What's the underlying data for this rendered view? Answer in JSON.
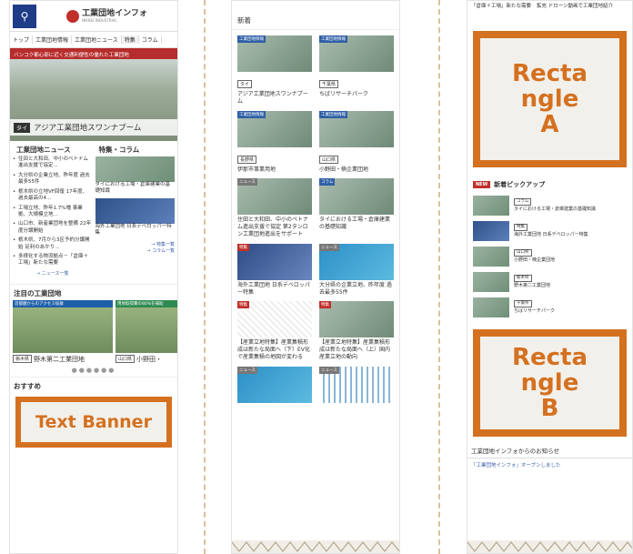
{
  "phone1": {
    "logo_text": "工業団地インフォ",
    "logo_sub": "NIKKEI INDUSTRIAL",
    "tabs": [
      "トップ",
      "工業団地情報",
      "工業団地ニュース",
      "特集",
      "コラム"
    ],
    "banner_text": "バンコク都心部に近く交通利便性の優れた工業団地",
    "hero_tag": "タイ",
    "hero_title": "アジア工業団地スワンナプーム",
    "news_title": "工業団地ニュース",
    "news_items": [
      "住田と大和田、中小のベトナム進出支援で協定…",
      "大分県の企業立地、昨年度 過去最多55件",
      "栃木県の立地VF回復 17年度、過去最高の4…",
      "工場立地、昨年1.7%増 事業拠、大規模立地…",
      "山口市、新産業団地を整備 22年度分譲開始",
      "栃木県、7月から3区予約分譲開始 足利のあかり…",
      "多様化する物流拠点－「倉庫＋工場」新たな需要"
    ],
    "news_more": "→ ニュース一覧",
    "feature_title": "特集・コラム",
    "features": [
      "タイにおける工場・倉庫建業の基礎知識",
      "海外工業団地 日系デベロッパー特集"
    ],
    "feature_more": "→ 特集一覧\n→ コラム一覧",
    "notable_title": "注目の工業団地",
    "carousel": [
      {
        "ribbon": "首都圏からのアクセス抜群",
        "pref": "栃木県",
        "name": "野木第二工業団地"
      },
      {
        "ribbon": "用地取得費の80%を補助",
        "pref": "山口県",
        "name": "小野田・"
      }
    ],
    "dots": "●●●●●●",
    "osusume": "おすすめ",
    "text_banner": "Text Banner"
  },
  "phone2": {
    "title": "新着",
    "cards": [
      {
        "label": "工業団地情報",
        "pref": "タイ",
        "caption": "アジア工業団地スワンナプーム",
        "style": ""
      },
      {
        "label": "工業団地情報",
        "pref": "千葉県",
        "caption": "ちばリサーチパーク",
        "style": ""
      },
      {
        "label": "工業団地情報",
        "pref": "長野県",
        "caption": "伊那市事業用地",
        "style": ""
      },
      {
        "label": "工業団地情報",
        "pref": "山口県",
        "caption": "小野田・楠企業団地",
        "style": ""
      },
      {
        "label": "ニュース",
        "pref": "",
        "caption": "住田と大和田、中小のベトナム進出支援で協定 第2タンロン工業団地進出をサポート",
        "style": ""
      },
      {
        "label": "コラム",
        "pref": "",
        "caption": "タイにおける工場・倉庫建業の基礎知識",
        "style": ""
      },
      {
        "label": "特集",
        "pref": "",
        "caption": "海外工業団地 日系デベロッパー特集",
        "style": "map"
      },
      {
        "label": "ニュース",
        "pref": "",
        "caption": "大分県の企業立地、昨年度 過去最多55件",
        "style": "blue"
      },
      {
        "label": "特集",
        "pref": "",
        "caption": "【産業立地特集】産業集積形成は新たな局面へ（下）EV化で産業集積の地図が変わる",
        "style": "diagram"
      },
      {
        "label": "特集",
        "pref": "",
        "caption": "【産業立地特集】産業集積形成は新たな局面へ（上）国内産業立地の動向",
        "style": ""
      },
      {
        "label": "ニュース",
        "pref": "",
        "caption": "",
        "style": "blue"
      },
      {
        "label": "ニュース",
        "pref": "",
        "caption": "",
        "style": "bars"
      }
    ]
  },
  "phone3": {
    "top_left": "「倉庫＋工場」新たな需要",
    "top_right": "鉱充 ドローン動画で工業団地紹介",
    "rect_a": "Recta\nngle\nA",
    "pickup_new": "NEW",
    "pickup_title": "新着ピックアップ",
    "pickups": [
      {
        "pref": "コラム",
        "text": "タイにおける工場・倉庫建業の基礎知識",
        "map": false
      },
      {
        "pref": "特集",
        "text": "海外工業団地 日系デベロッパー特集",
        "map": true
      },
      {
        "pref": "山口県",
        "text": "小野田・楠企業団地",
        "map": false
      },
      {
        "pref": "栃木県",
        "text": "野木第二工業団地",
        "map": false
      },
      {
        "pref": "千葉県",
        "text": "ちばリサーチパーク",
        "map": false
      }
    ],
    "rect_b": "Recta\nngle\nB",
    "info_title": "工業団地インフォからのお知らせ",
    "info_item": "「工業団地インフォ」オープンしました"
  }
}
